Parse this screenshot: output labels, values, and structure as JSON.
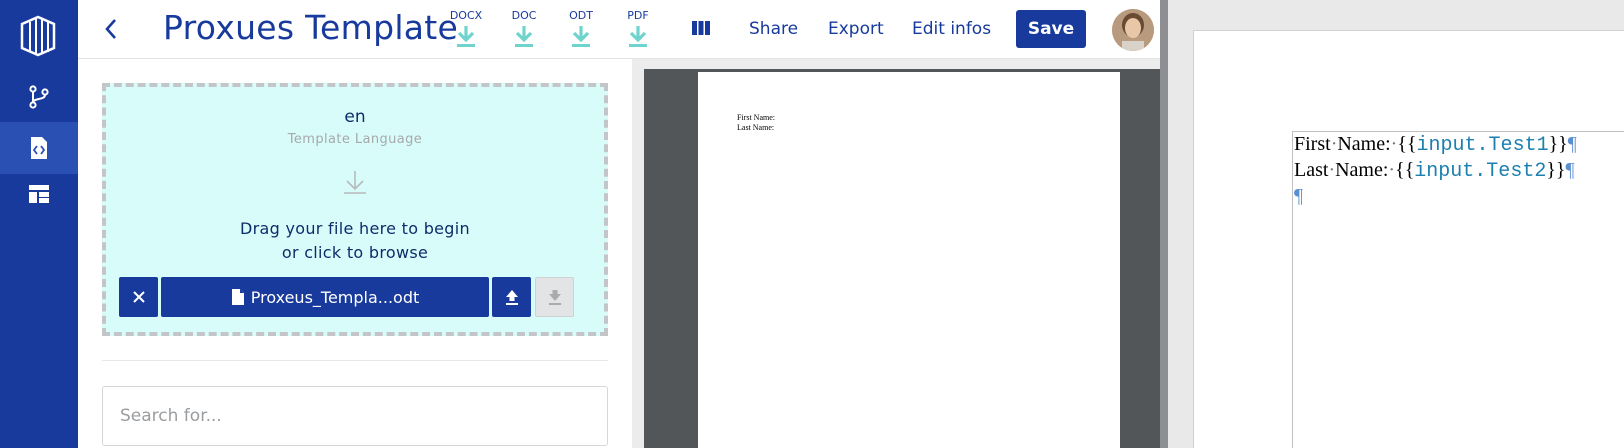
{
  "header": {
    "title": "Proxues Template",
    "downloads": [
      {
        "label": "DOCX"
      },
      {
        "label": "DOC"
      },
      {
        "label": "ODT"
      },
      {
        "label": "PDF"
      }
    ],
    "share_label": "Share",
    "export_label": "Export",
    "edit_infos_label": "Edit infos",
    "save_label": "Save"
  },
  "dropzone": {
    "language": "en",
    "language_caption": "Template Language",
    "drag_line1": "Drag your file here to begin",
    "drag_line2": "or click to browse",
    "file_name": "Proxeus_Templa...odt"
  },
  "search": {
    "placeholder": "Search for..."
  },
  "preview": {
    "line1": "First Name:",
    "line2": "Last Name:"
  },
  "editor": {
    "line1_label": "First",
    "line1_label2": "Name:",
    "line1_open": "{{",
    "line1_var": "input.Test1",
    "line1_close": "}}",
    "line2_label": "Last",
    "line2_label2": "Name:",
    "line2_open": "{{",
    "line2_var": "input.Test2",
    "line2_close": "}}",
    "pilcrow": "¶",
    "space_mark": "·"
  },
  "colors": {
    "nav_bg": "#173a9c",
    "accent": "#173a9c",
    "dropzone_bg": "#d8fcfa",
    "download_arrow": "#6fd4cd"
  }
}
